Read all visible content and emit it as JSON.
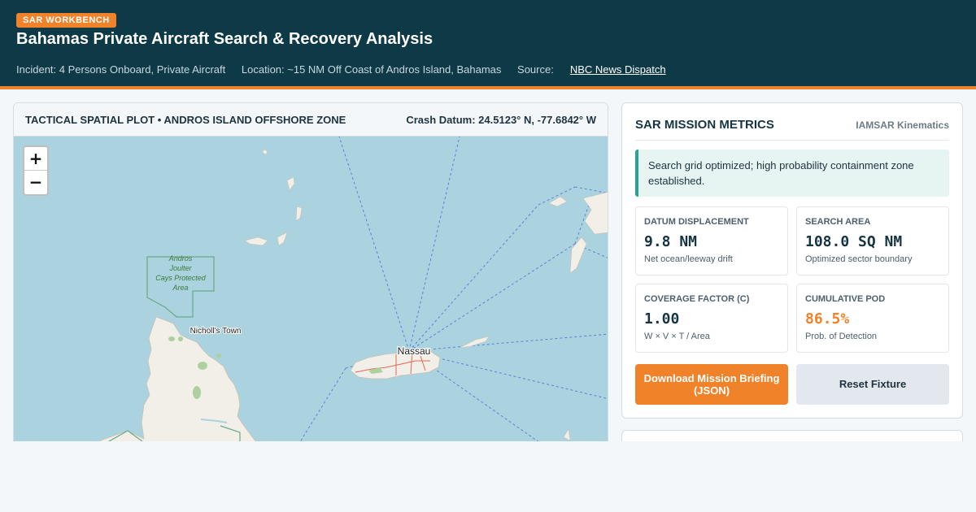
{
  "header": {
    "badge": "SAR WORKBENCH",
    "title": "Bahamas Private Aircraft Search & Recovery Analysis",
    "incident": "Incident: 4 Persons Onboard, Private Aircraft",
    "location": "Location: ~15 NM Off Coast of Andros Island, Bahamas",
    "source_label": "Source:",
    "source_link": "NBC News Dispatch"
  },
  "map": {
    "title": "TACTICAL SPATIAL PLOT • ANDROS ISLAND OFFSHORE ZONE",
    "datum": "Crash Datum: 24.5123° N, -77.6842° W",
    "zoom_in": "+",
    "zoom_out": "−",
    "labels": {
      "park_line1": "Andros",
      "park_line2": "Joulter",
      "park_line3": "Cays Protected",
      "park_line4": "Area",
      "town": "Nicholl's Town",
      "city": "Nassau"
    }
  },
  "metrics": {
    "title": "SAR MISSION METRICS",
    "subtitle": "IAMSAR Kinematics",
    "alert": "Search grid optimized; high probability containment zone established.",
    "cards": [
      {
        "label": "DATUM DISPLACEMENT",
        "value": "9.8 NM",
        "note": "Net ocean/leeway drift"
      },
      {
        "label": "SEARCH AREA",
        "value": "108.0 SQ NM",
        "note": "Optimized sector boundary"
      },
      {
        "label": "COVERAGE FACTOR (C)",
        "value": "1.00",
        "note": "W × V × T / Area"
      },
      {
        "label": "CUMULATIVE POD",
        "value": "86.5%",
        "note": "Prob. of Detection"
      }
    ],
    "download_button": "Download Mission Briefing (JSON)",
    "reset_button": "Reset Fixture"
  },
  "colors": {
    "header_bg": "#0e3a47",
    "accent": "#f0822a",
    "water": "#aad3df",
    "land": "#f2efe9",
    "alert_bar": "#2aa393"
  }
}
